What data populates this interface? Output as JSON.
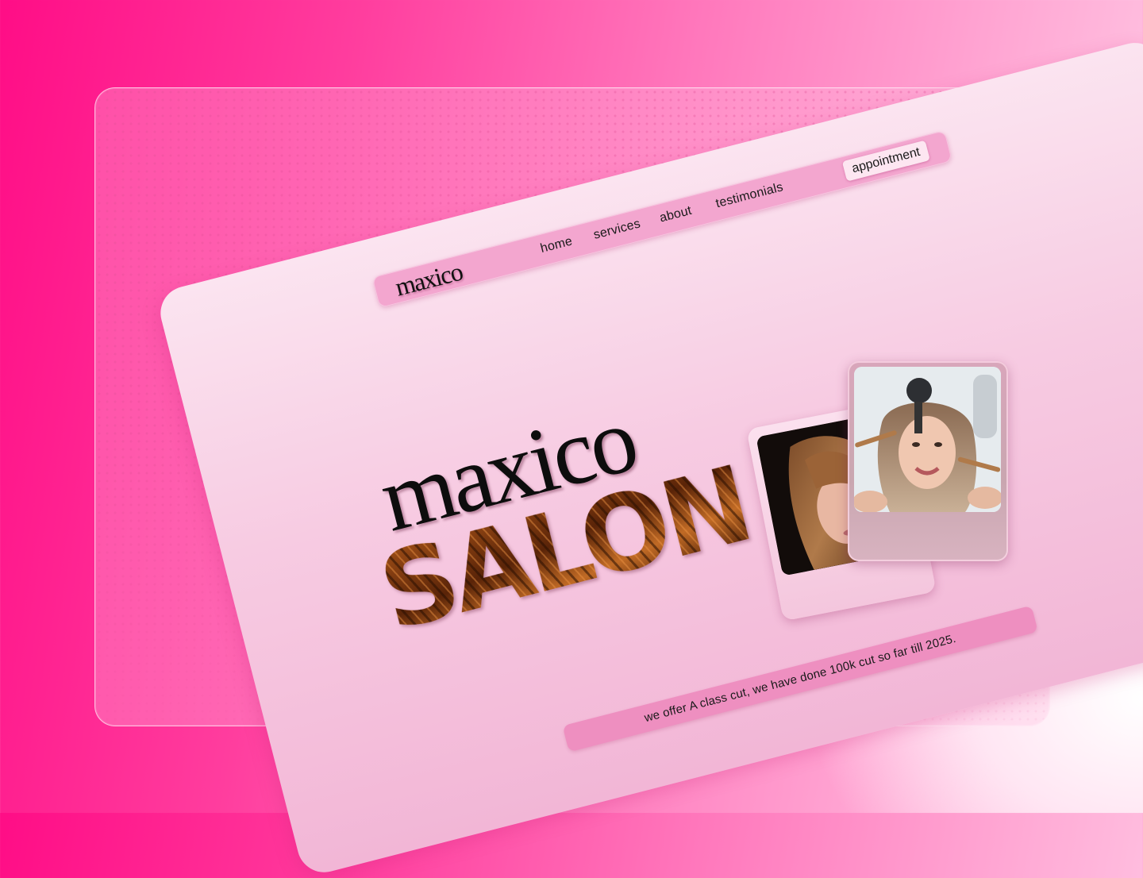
{
  "brand": {
    "logo_text": "maxico"
  },
  "nav": {
    "links": [
      "home",
      "services",
      "about",
      "testimonials"
    ],
    "cta_label": "appointment"
  },
  "hero": {
    "title_top": "maxico",
    "title_bottom": "SALON",
    "tagline": "we offer A class cut, we have done 100k cut so far till 2025."
  },
  "photos": [
    {
      "icon": "woman-hair-photo"
    },
    {
      "icon": "woman-makeup-salon-photo"
    }
  ],
  "colors": {
    "background": "#ff3d9e",
    "card": "#f7cbe2",
    "nav_bar": "#f3a6cf",
    "tagline_bar": "#ee8fc0",
    "button": "#fde6f1",
    "text": "#111111",
    "salon_fill": "#6b300e"
  }
}
